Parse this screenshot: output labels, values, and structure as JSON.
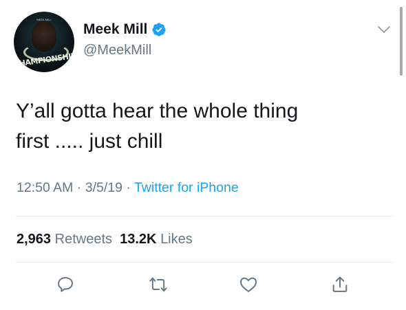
{
  "user": {
    "name": "Meek Mill",
    "handle": "@MeekMill",
    "avatar_text": "CHAMPIONSHIPS",
    "avatar_small_text": "MEEK MILL"
  },
  "tweet": {
    "text_line1": "Y’all gotta hear the whole thing",
    "text_line2": "first ..... just chill",
    "time": "12:50 AM",
    "date": "3/5/19",
    "source": "Twitter for iPhone",
    "separator": " · "
  },
  "stats": {
    "retweets_count": "2,963",
    "retweets_label": "Retweets",
    "likes_count": "13.2K",
    "likes_label": "Likes"
  },
  "actions": [
    {
      "icon": "reply-icon"
    },
    {
      "icon": "retweet-icon"
    },
    {
      "icon": "like-icon"
    },
    {
      "icon": "share-icon"
    }
  ],
  "colors": {
    "text": "#14171a",
    "secondary": "#657786",
    "accent": "#1da1f2",
    "divider": "#e1e8ed"
  }
}
